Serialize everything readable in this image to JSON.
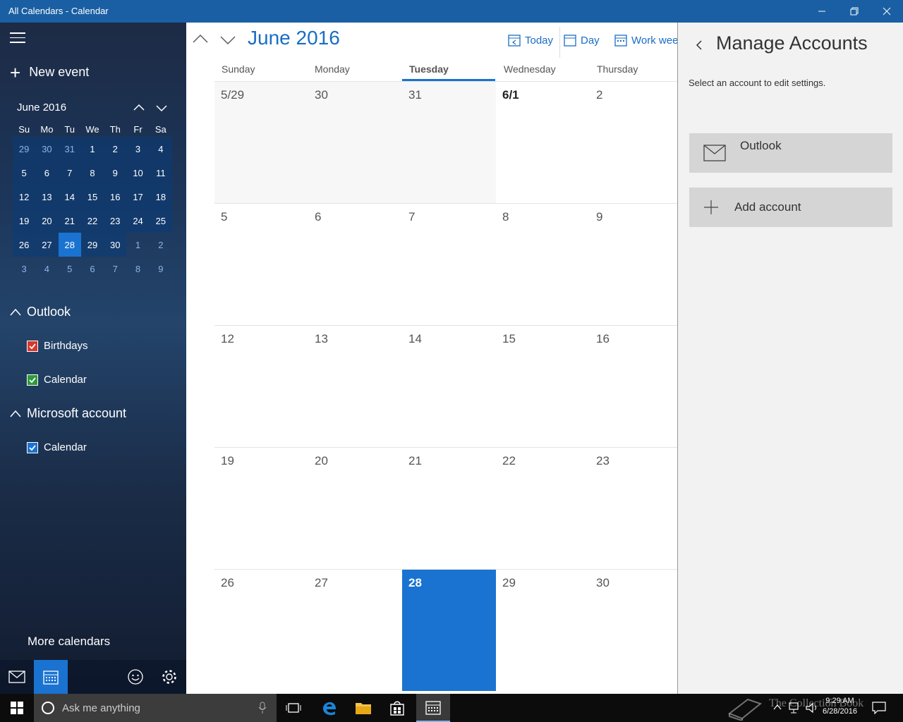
{
  "window": {
    "title": "All Calendars - Calendar"
  },
  "sidebar": {
    "new_event": "New event",
    "mini_calendar": {
      "title": "June 2016",
      "weekdays": [
        "Su",
        "Mo",
        "Tu",
        "We",
        "Th",
        "Fr",
        "Sa"
      ],
      "weeks": [
        [
          "29",
          "30",
          "31",
          "1",
          "2",
          "3",
          "4"
        ],
        [
          "5",
          "6",
          "7",
          "8",
          "9",
          "10",
          "11"
        ],
        [
          "12",
          "13",
          "14",
          "15",
          "16",
          "17",
          "18"
        ],
        [
          "19",
          "20",
          "21",
          "22",
          "23",
          "24",
          "25"
        ],
        [
          "26",
          "27",
          "28",
          "29",
          "30",
          "1",
          "2"
        ],
        [
          "3",
          "4",
          "5",
          "6",
          "7",
          "8",
          "9"
        ]
      ]
    },
    "accounts": [
      {
        "name": "Outlook",
        "calendars": [
          "Birthdays",
          "Calendar"
        ]
      },
      {
        "name": "Microsoft account",
        "calendars": [
          "Calendar"
        ]
      }
    ],
    "more_calendars": "More calendars"
  },
  "main": {
    "month_title": "June 2016",
    "views": {
      "today": "Today",
      "day": "Day",
      "work_week": "Work weel"
    },
    "weekdays": [
      "Sunday",
      "Monday",
      "Tuesday",
      "Wednesday",
      "Thursday"
    ],
    "weeks": [
      [
        "5/29",
        "30",
        "31",
        "6/1",
        "2"
      ],
      [
        "5",
        "6",
        "7",
        "8",
        "9"
      ],
      [
        "12",
        "13",
        "14",
        "15",
        "16"
      ],
      [
        "19",
        "20",
        "21",
        "22",
        "23"
      ],
      [
        "26",
        "27",
        "28",
        "29",
        "30"
      ]
    ]
  },
  "panel": {
    "title": "Manage Accounts",
    "subtitle": "Select an account to edit settings.",
    "account_label": "Outlook",
    "add_account": "Add account"
  },
  "taskbar": {
    "search_placeholder": "Ask me anything",
    "time": "9:29 AM",
    "date": "6/28/2016",
    "watermark": "The Collection Book"
  },
  "colors": {
    "accent": "#1a73d0",
    "titlebar": "#1a5fa3",
    "checkbox_red": "#d8372b",
    "checkbox_green": "#2e9b3c",
    "checkbox_blue": "#1a73d0"
  }
}
